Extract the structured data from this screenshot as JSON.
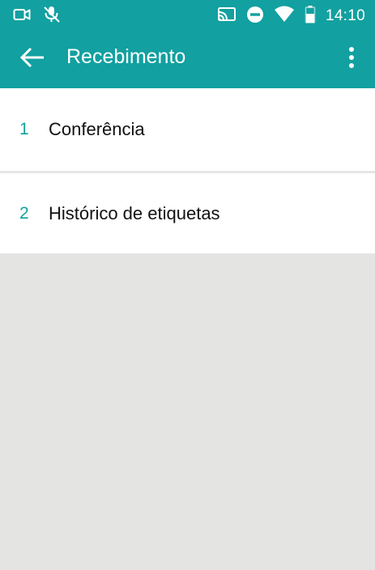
{
  "status_bar": {
    "time": "14:10",
    "left_icons": [
      "video-camera-icon",
      "mic-off-icon"
    ],
    "right_icons": [
      "cast-icon",
      "do-not-disturb-icon",
      "wifi-icon",
      "battery-icon"
    ]
  },
  "app_bar": {
    "title": "Recebimento",
    "back_icon": "arrow-left-icon",
    "menu_icon": "more-vertical-icon",
    "color": "#12a0a0"
  },
  "menu": {
    "items": [
      {
        "number": "1",
        "label": "Conferência"
      },
      {
        "number": "2",
        "label": "Histórico de etiquetas"
      }
    ]
  }
}
